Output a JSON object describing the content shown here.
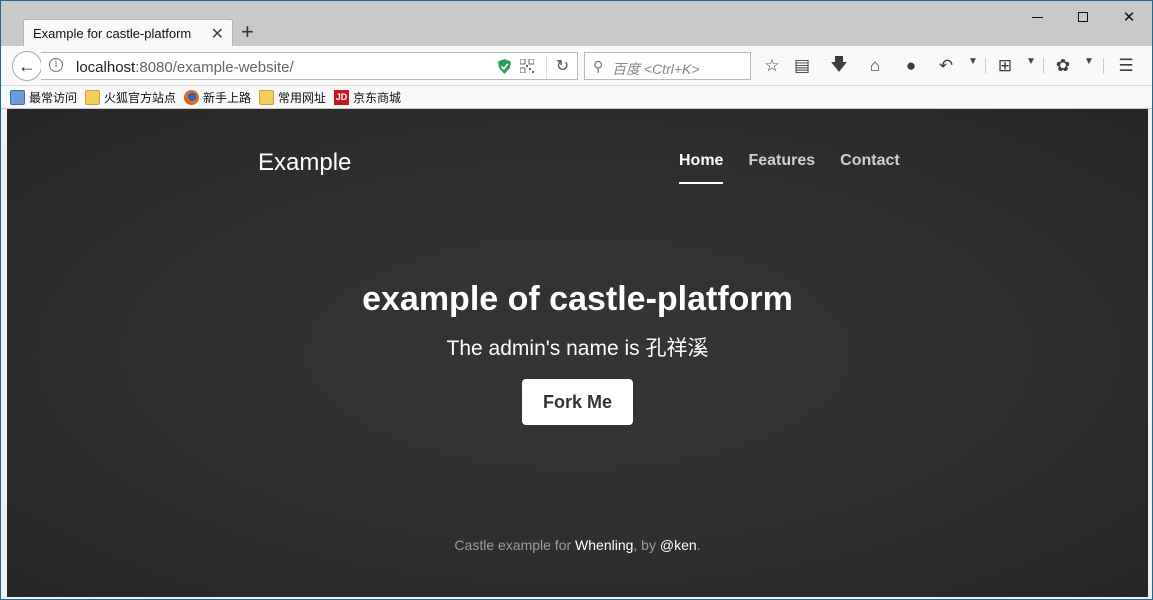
{
  "browser": {
    "tab_title": "Example for castle-platform",
    "tab_close": "✕",
    "new_tab": "+",
    "url_host": "localhost",
    "url_rest": ":8080/example-website/",
    "search_placeholder": "百度 <Ctrl+K>",
    "bookmarks": [
      "最常访问",
      "火狐官方站点",
      "新手上路",
      "常用网址",
      "京东商城"
    ],
    "jd_logo": "JD"
  },
  "site": {
    "brand": "Example",
    "nav": [
      "Home",
      "Features",
      "Contact"
    ],
    "hero_title": "example of castle-platform",
    "hero_subtitle": "The admin's name is 孔祥溪",
    "fork_button": "Fork Me",
    "footer": {
      "prefix": "Castle example for ",
      "link1": "Whenling",
      "middle": ", by ",
      "link2": "@ken",
      "suffix": "."
    }
  }
}
